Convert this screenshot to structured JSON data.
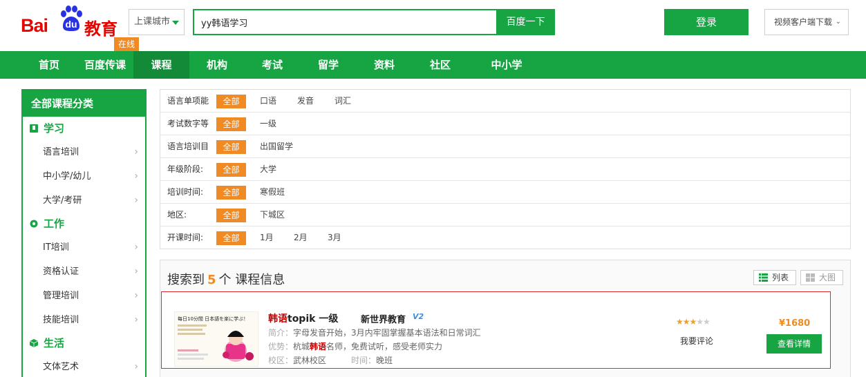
{
  "logo": {
    "bai": "Bai",
    "du": "du",
    "jiaoyu": "教育",
    "online": "在线"
  },
  "header": {
    "city_select": "上课城市",
    "search_value": "yy韩语学习",
    "search_button": "百度一下",
    "login_button": "登录",
    "client_download": "视频客户端下载"
  },
  "nav": {
    "items": [
      {
        "label": "首页"
      },
      {
        "label": "百度传课"
      },
      {
        "label": "课程"
      },
      {
        "label": "机构"
      },
      {
        "label": "考试"
      },
      {
        "label": "留学"
      },
      {
        "label": "资料"
      },
      {
        "label": "社区"
      },
      {
        "label": "中小学"
      }
    ],
    "active_index": 2
  },
  "sidebar": {
    "title": "全部课程分类",
    "categories": [
      {
        "label": "学习",
        "icon": "book-icon",
        "items": [
          {
            "label": "语言培训"
          },
          {
            "label": "中小学/幼儿"
          },
          {
            "label": "大学/考研"
          }
        ]
      },
      {
        "label": "工作",
        "icon": "gear-icon",
        "items": [
          {
            "label": "IT培训"
          },
          {
            "label": "资格认证"
          },
          {
            "label": "管理培训"
          },
          {
            "label": "技能培训"
          }
        ]
      },
      {
        "label": "生活",
        "icon": "cube-icon",
        "items": [
          {
            "label": "文体艺术"
          }
        ]
      }
    ]
  },
  "filters": {
    "all_label": "全部",
    "rows": [
      {
        "label": "语言单项能",
        "options": [
          "口语",
          "发音",
          "词汇"
        ]
      },
      {
        "label": "考试数字等",
        "options": [
          "一级"
        ]
      },
      {
        "label": "语言培训目",
        "options": [
          "出国留学"
        ]
      },
      {
        "label": "年级阶段:",
        "options": [
          "大学"
        ]
      },
      {
        "label": "培训时间:",
        "options": [
          "寒假班"
        ]
      },
      {
        "label": "地区:",
        "options": [
          "下城区"
        ]
      },
      {
        "label": "开课时间:",
        "options": [
          "1月",
          "2月",
          "3月"
        ]
      }
    ]
  },
  "results": {
    "prefix": "搜索到",
    "count": "5",
    "suffix": "个 课程信息",
    "view_list": "列表",
    "view_grid": "大图"
  },
  "course": {
    "title_hl": "韩语",
    "title_rest": "topik 一级",
    "org": "新世界教育",
    "org_badge": "V2",
    "intro_key": "简介：",
    "intro": "字母发音开始，3月内牢固掌握基本语法和日常词汇",
    "adv_key": "优势：",
    "adv_pre": "杭城",
    "adv_hl": "韩语",
    "adv_post": "名师，免费试听，感受老师实力",
    "campus_key": "校区：",
    "campus": "武林校区",
    "time_key": "时间：",
    "time": "晚班",
    "rating": 3,
    "rating_max": 5,
    "review": "我要评论",
    "price": "¥1680",
    "detail_button": "查看详情",
    "thumb_text": "每日10分間 日本語を楽に学ぶ！"
  },
  "colors": {
    "brand_green": "#17a544",
    "accent_orange": "#f08a24",
    "logo_red": "#e10601"
  }
}
